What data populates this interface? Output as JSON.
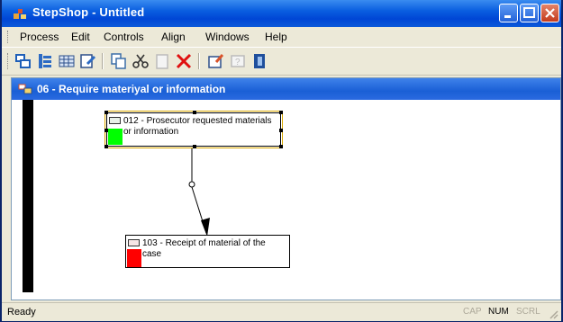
{
  "window": {
    "title": "StepShop - Untitled"
  },
  "menu": {
    "items": [
      "Process",
      "Edit",
      "Controls",
      "Align",
      "Windows",
      "Help"
    ]
  },
  "toolbar": {
    "buttons": [
      "new-process-icon",
      "properties-icon",
      "grid-icon",
      "edit-icon",
      "copy-icon",
      "cut-icon",
      "paste-icon",
      "delete-icon",
      "settings-icon",
      "help-icon",
      "exit-icon"
    ]
  },
  "child_window": {
    "title": "06 - Require materiyal or information",
    "steps": [
      {
        "text": "012 - Prosecutor requested materials or information",
        "color": "#00ff00"
      },
      {
        "text": "103 - Receipt of material of the case",
        "color": "#ff0000"
      }
    ]
  },
  "status": {
    "text": "Ready",
    "indicators": [
      {
        "label": "CAP",
        "active": false
      },
      {
        "label": "NUM",
        "active": true
      },
      {
        "label": "SCRL",
        "active": false
      }
    ]
  }
}
